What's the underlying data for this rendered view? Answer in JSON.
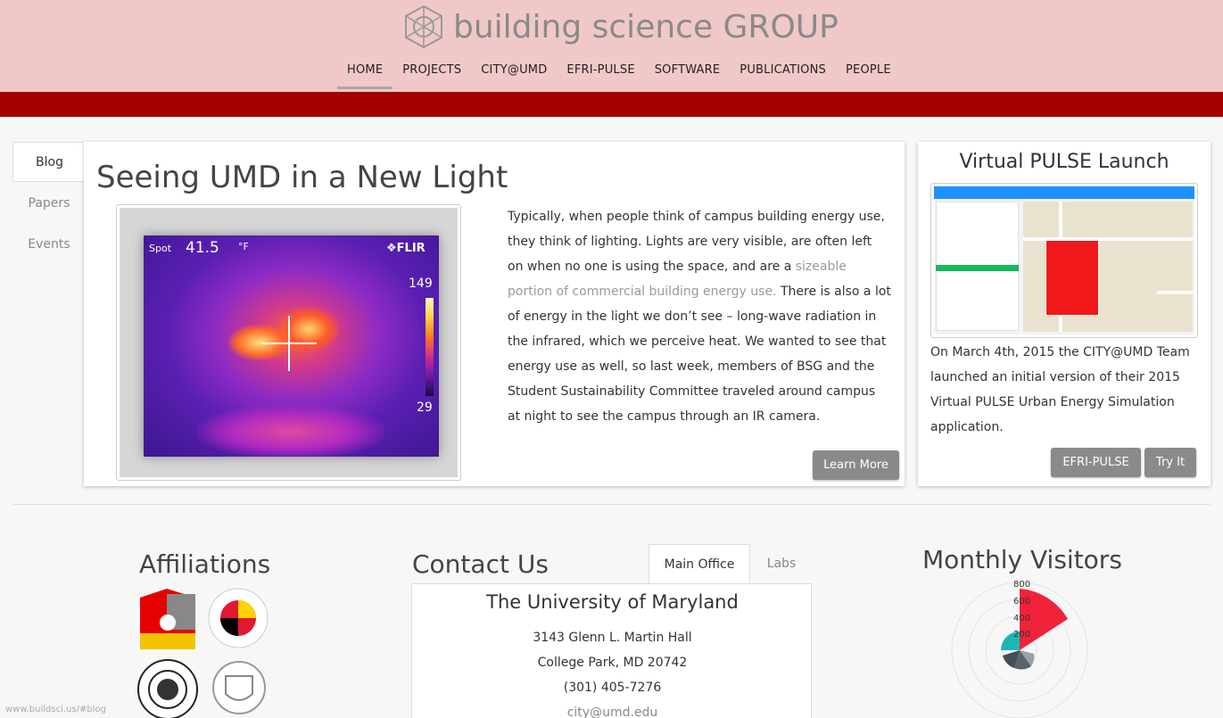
{
  "header": {
    "brand": "building science GROUP",
    "nav": [
      {
        "label": "HOME"
      },
      {
        "label": "PROJECTS"
      },
      {
        "label": "CITY@UMD"
      },
      {
        "label": "EFRI-PULSE"
      },
      {
        "label": "SOFTWARE"
      },
      {
        "label": "PUBLICATIONS"
      },
      {
        "label": "PEOPLE"
      }
    ]
  },
  "sidetabs": [
    {
      "label": "Blog"
    },
    {
      "label": "Papers"
    },
    {
      "label": "Events"
    }
  ],
  "blog": {
    "title": "Seeing UMD in a New Light",
    "thermal": {
      "spot_label": "Spot",
      "spot_value": "41.5",
      "unit": "°F",
      "brand": "❖FLIR",
      "scale_max": "149",
      "scale_min": "29"
    },
    "text_before": "Typically, when people think of campus building energy use, they think of lighting. Lights are very visible, are often left on when no one is using the space, and are a ",
    "text_link": "sizeable portion of commercial building energy use.",
    "text_after": " There is also a lot of energy in the light we don’t see – long-wave radiation in the infrared, which we perceive heat. We wanted to see that energy use as well, so last week, members of BSG and the Student Sustainability Committee traveled around campus at night to see the campus through an IR camera.",
    "button": "Learn More"
  },
  "virtual_pulse": {
    "title": "Virtual PULSE Launch",
    "text": "On March 4th, 2015 the CITY@UMD Team launched an initial version of their 2015 Virtual PULSE Urban Energy Simulation application.",
    "button_efri": "EFRI-PULSE",
    "button_try": "Try It"
  },
  "affiliations": {
    "title": "Affiliations"
  },
  "contact": {
    "title": "Contact Us",
    "tabs": [
      {
        "label": "Main Office"
      },
      {
        "label": "Labs"
      }
    ],
    "org": "The University of Maryland",
    "line1": "3143 Glenn L. Martin Hall",
    "line2": "College Park, MD 20742",
    "phone": "(301) 405-7276",
    "email": "city@umd.edu"
  },
  "visitors": {
    "title": "Monthly Visitors",
    "ticks": [
      "800",
      "600",
      "400",
      "200"
    ]
  },
  "status_bar": {
    "url": "www.buildsci.us/#blog"
  },
  "colors": {
    "header_bg": "#f0c8c8",
    "accent_red": "#a50000",
    "button_gray": "#8a8a8a"
  }
}
